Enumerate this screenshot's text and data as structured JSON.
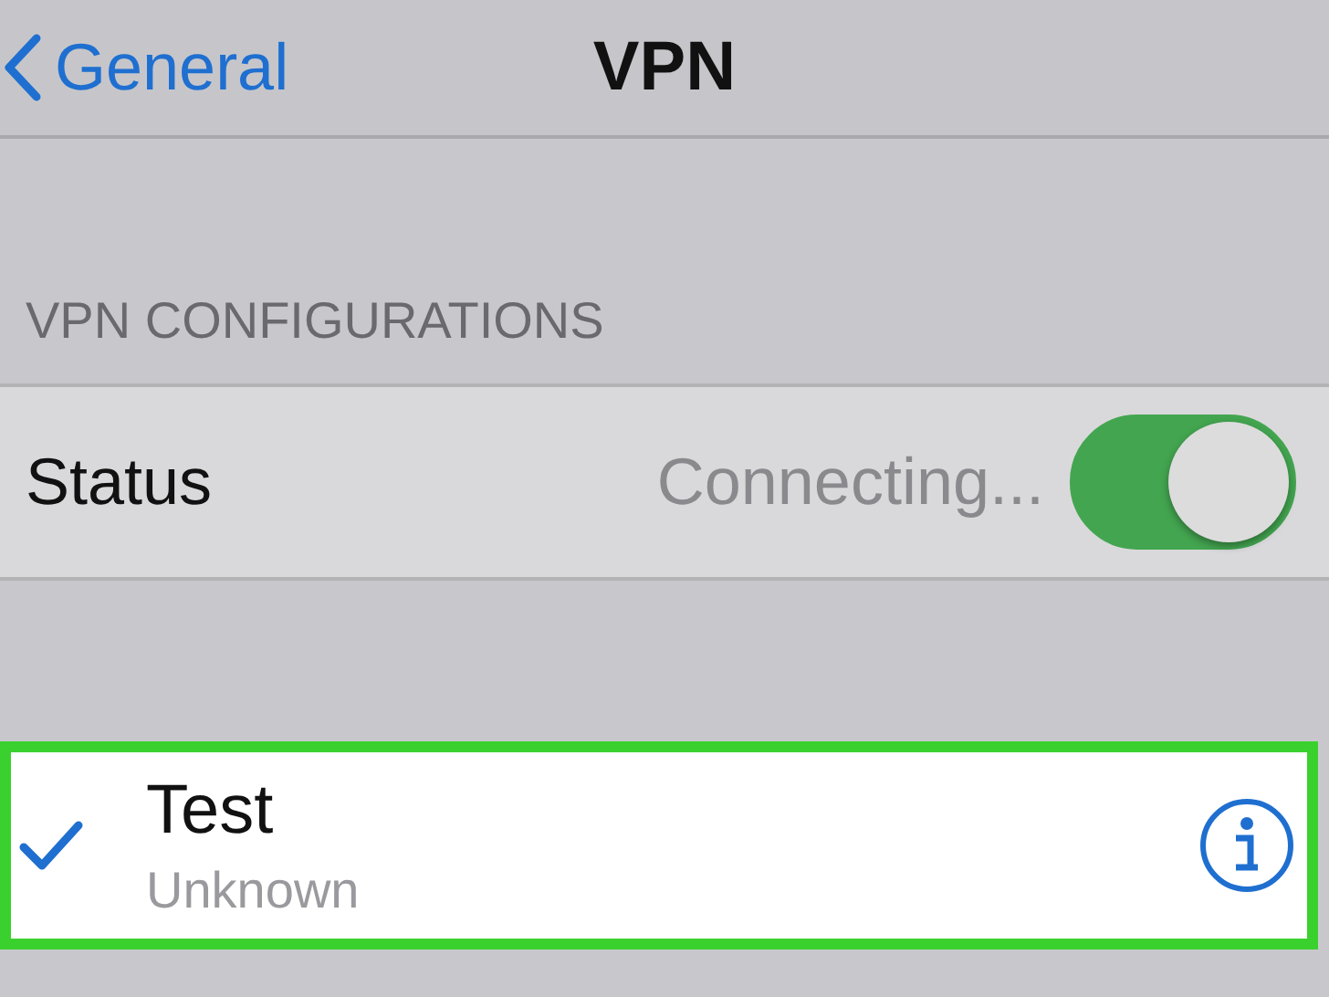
{
  "nav": {
    "back_label": "General",
    "title": "VPN"
  },
  "section_header": "VPN CONFIGURATIONS",
  "status_row": {
    "label": "Status",
    "value": "Connecting...",
    "on": true
  },
  "configurations": [
    {
      "name": "Test",
      "subtitle": "Unknown",
      "selected": true,
      "highlighted": true
    }
  ]
}
